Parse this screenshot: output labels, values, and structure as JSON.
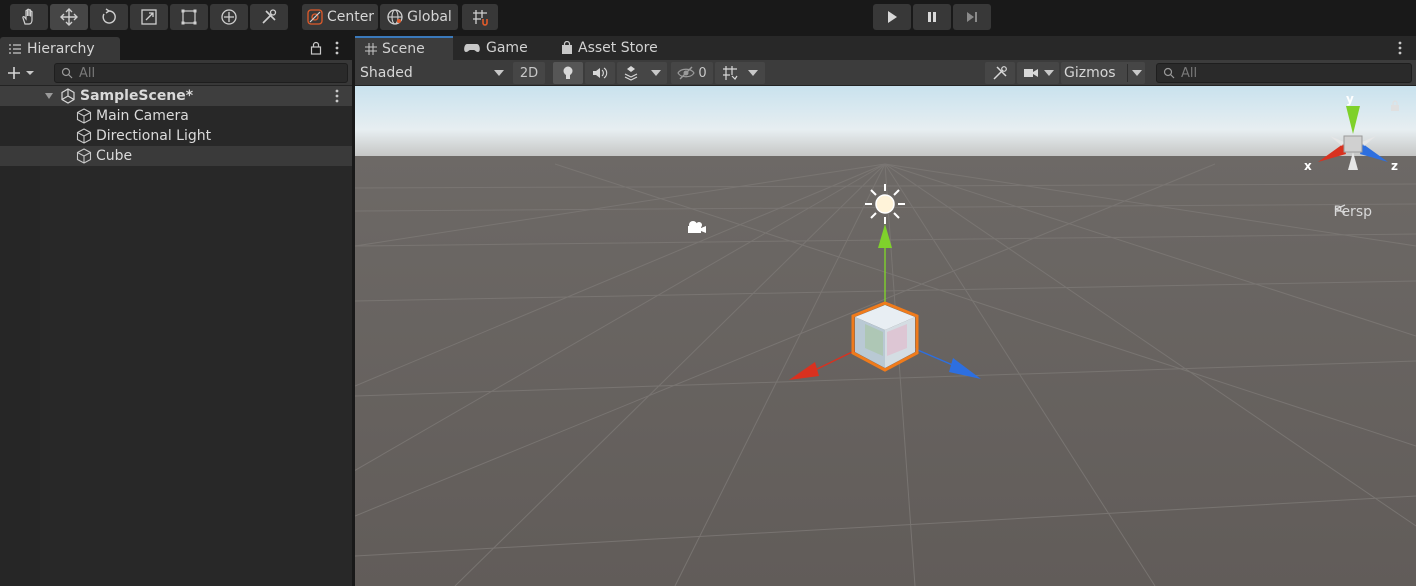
{
  "toolbar": {
    "tools": [
      "hand-tool",
      "move-tool",
      "rotate-tool",
      "scale-tool",
      "rect-tool",
      "transform-tool",
      "custom-tool"
    ],
    "pivot_mode": "Center",
    "pivot_rotation": "Global",
    "snap_icon": "grid-snap-icon"
  },
  "hierarchy": {
    "tab_label": "Hierarchy",
    "search_placeholder": "All",
    "scene_name": "SampleScene*",
    "items": [
      {
        "label": "Main Camera"
      },
      {
        "label": "Directional Light"
      },
      {
        "label": "Cube"
      }
    ]
  },
  "scene_panel": {
    "tabs": [
      {
        "label": "Scene"
      },
      {
        "label": "Game"
      },
      {
        "label": "Asset Store"
      }
    ],
    "shading_mode": "Shaded",
    "mode_2d": "2D",
    "hidden_count": "0",
    "gizmos_label": "Gizmos",
    "search_placeholder": "All",
    "projection_label": "Persp",
    "axis_labels": {
      "x": "x",
      "y": "y",
      "z": "z"
    }
  },
  "colors": {
    "x_axis": "#d9311f",
    "y_axis": "#7fd12b",
    "z_axis": "#2d6fe0",
    "selection_outline": "#f07b1b",
    "accent_tab": "#3a79bb"
  }
}
